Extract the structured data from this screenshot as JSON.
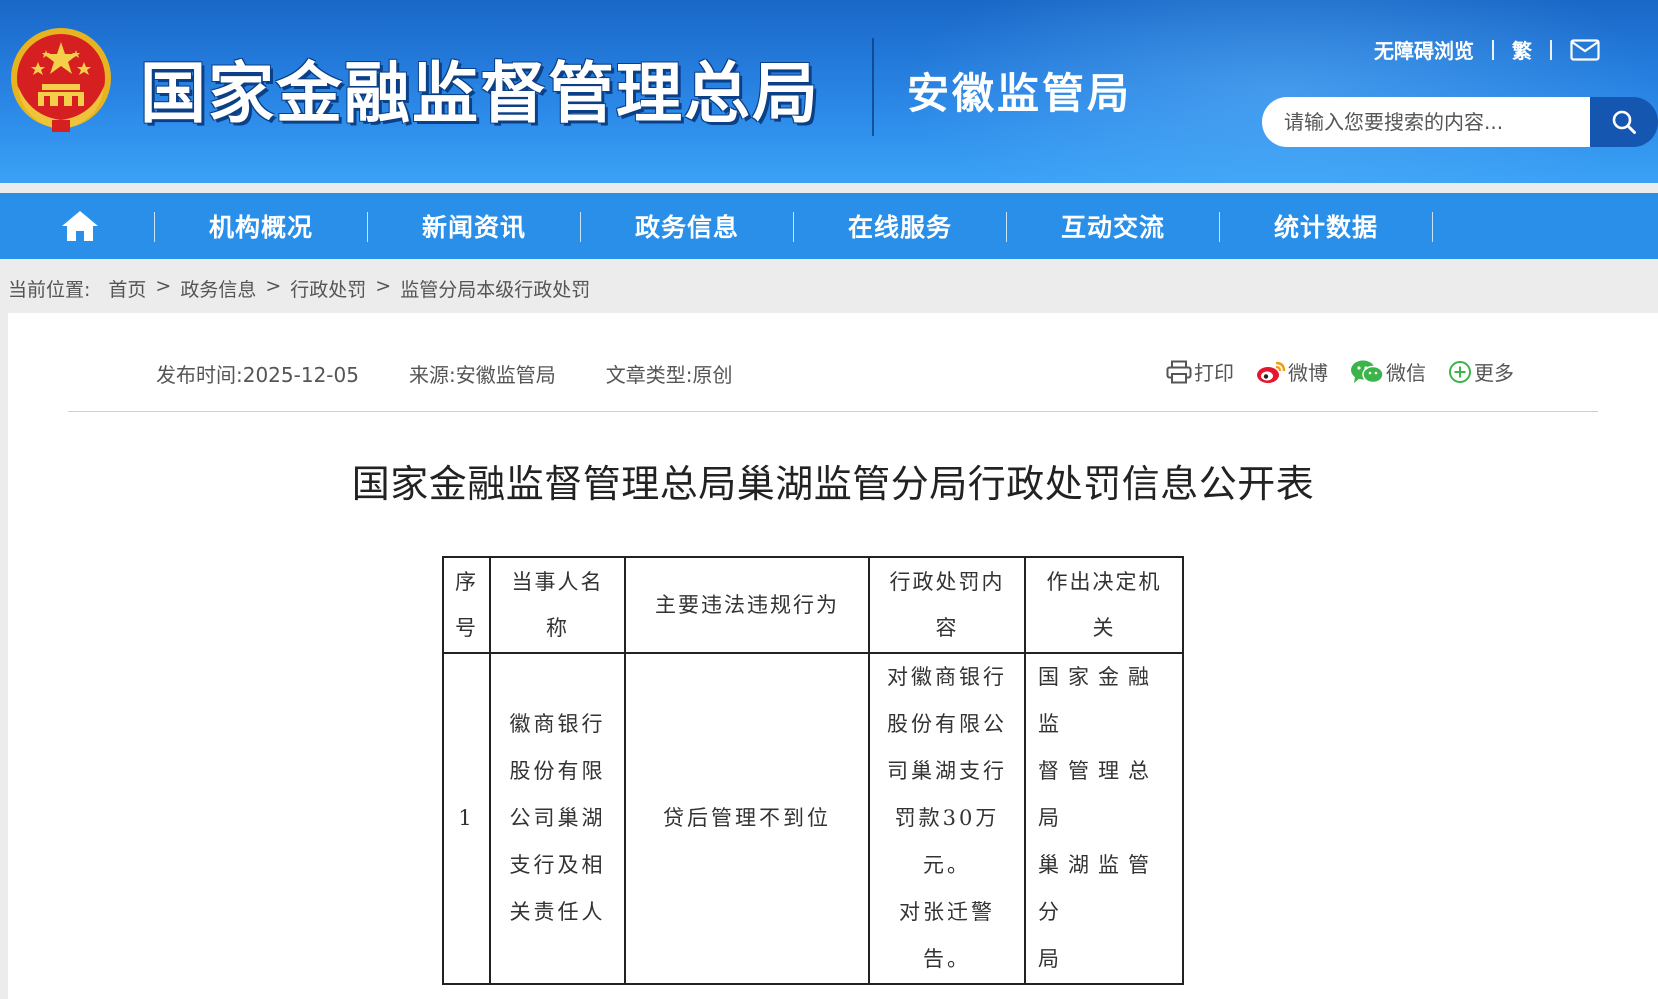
{
  "header": {
    "org_title": "国家金融监督管理总局",
    "sub_title": "安徽监管局",
    "links": {
      "accessibility": "无障碍浏览",
      "traditional": "繁"
    },
    "search_placeholder": "请输入您要搜索的内容...",
    "colors": {
      "header_bg": "#2a86e6",
      "nav_bg": "#2a8fe8",
      "search_button": "#1557b0"
    }
  },
  "nav": {
    "items": [
      "机构概况",
      "新闻资讯",
      "政务信息",
      "在线服务",
      "互动交流",
      "统计数据"
    ]
  },
  "breadcrumb": {
    "label": "当前位置:",
    "items": [
      "首页",
      "政务信息",
      "行政处罚",
      "监管分局本级行政处罚"
    ],
    "separator": ">"
  },
  "article": {
    "meta": {
      "publish": "发布时间:2025-12-05",
      "source": "来源:安徽监管局",
      "type": "文章类型:原创"
    },
    "share": {
      "print": "打印",
      "weibo": "微博",
      "wechat": "微信",
      "more": "更多"
    },
    "title": "国家金融监督管理总局巢湖监管分局行政处罚信息公开表",
    "table": {
      "headers": {
        "index": [
          "序",
          "号"
        ],
        "party": [
          "当事人名",
          "称"
        ],
        "violation": "主要违法违规行为",
        "penalty": [
          "行政处罚内",
          "容"
        ],
        "authority": [
          "作出决定机",
          "关"
        ]
      },
      "rows": [
        {
          "index": "1",
          "party_lines": [
            "徽商银行",
            "股份有限",
            "公司巢湖",
            "支行及相",
            "关责任人"
          ],
          "violation": "贷后管理不到位",
          "penalty_lines": [
            "对徽商银行",
            "股份有限公",
            "司巢湖支行",
            "罚款30万",
            "元。",
            "对张迁警",
            "告。"
          ],
          "authority_lines": [
            "国家金融监",
            "督管理总局",
            "巢湖监管分",
            "局"
          ]
        }
      ]
    }
  }
}
